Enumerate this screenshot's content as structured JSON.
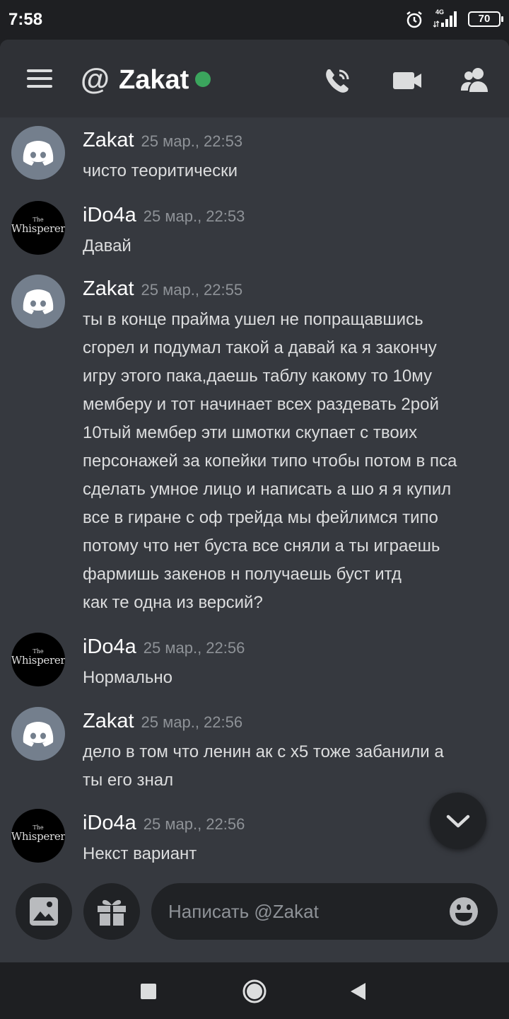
{
  "status_bar": {
    "time": "7:58",
    "network": "4G",
    "battery": "70"
  },
  "header": {
    "at_symbol": "@",
    "title": "Zakat",
    "online_color": "#3ba55d"
  },
  "messages": [
    {
      "author": "Zakat",
      "timestamp": "25 мар., 22:53",
      "avatar": "discord-default-avatar",
      "text": "чисто теоритически"
    },
    {
      "author": "iDo4a",
      "timestamp": "25 мар., 22:53",
      "avatar_text_small": "The",
      "avatar_text": "Whisperer",
      "text": "Давай"
    },
    {
      "author": "Zakat",
      "timestamp": "25 мар., 22:55",
      "avatar": "discord-default-avatar",
      "lines": [
        "ты в конце прайма ушел не попращавшись",
        "сгорел и подумал такой а давай ка я закончу",
        "игру этого пака,даешь таблу какому то 10му",
        "мемберу и тот начинает всех раздевать 2рой",
        "10тый мембер эти шмотки скупает  с твоих",
        "персонажей за копейки типо чтобы потом в пса",
        "сделать умное лицо и написать а шо я я купил",
        "все в гиране с оф трейда мы фейлимся типо",
        "потому что нет буста все сняли а ты играешь",
        "фармишь закенов н  получаешь буст итд",
        "как те одна из версий?"
      ]
    },
    {
      "author": "iDo4a",
      "timestamp": "25 мар., 22:56",
      "avatar_text_small": "The",
      "avatar_text": "Whisperer",
      "text": "Нормально"
    },
    {
      "author": "Zakat",
      "timestamp": "25 мар., 22:56",
      "avatar": "discord-default-avatar",
      "lines": [
        "дело в том что ленин ак с х5 тоже забанили а",
        "ты его знал"
      ]
    },
    {
      "author": "iDo4a",
      "timestamp": "25 мар., 22:56",
      "avatar_text_small": "The",
      "avatar_text": "Whisperer",
      "text": "Некст вариант"
    }
  ],
  "composer": {
    "placeholder": "Написать @Zakat"
  },
  "icons": {
    "header": [
      "menu-icon",
      "at-icon",
      "call-icon",
      "video-icon",
      "members-icon"
    ],
    "composer": [
      "image-icon",
      "gift-icon",
      "emoji-icon"
    ],
    "navigation": [
      "recents-icon",
      "home-icon",
      "back-icon"
    ]
  },
  "colors": {
    "background": "#36393f",
    "header": "#2f3136",
    "input": "#202225",
    "timestamp": "#8e9297"
  }
}
